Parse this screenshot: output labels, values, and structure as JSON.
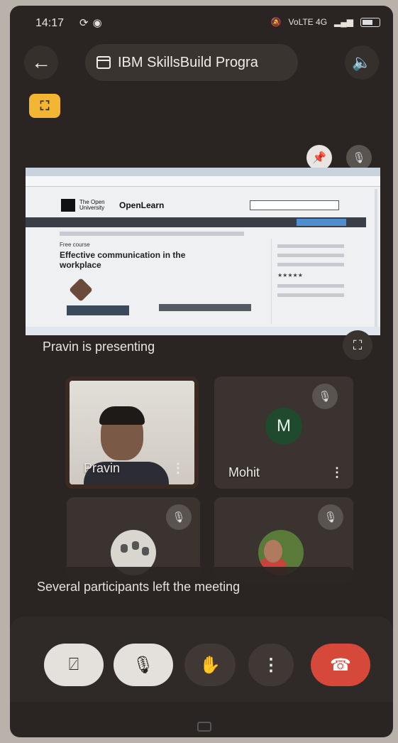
{
  "status_bar": {
    "time": "14:17",
    "left_icons": [
      "sync-icon",
      "whatsapp-icon"
    ],
    "right_text": "VoLTE 4G"
  },
  "header": {
    "back_icon": "arrow-left-icon",
    "title": "IBM SkillsBuild Progra",
    "title_icon": "calendar-icon",
    "speaker_icon": "speaker-icon"
  },
  "app_badge": {
    "text": "⛶",
    "color": "#f2b632"
  },
  "screen_share": {
    "presenter_label": "Pravin is presenting",
    "content": {
      "site_brand": "OpenLearn",
      "university": "The Open University",
      "free_course_label": "Free course",
      "course_title": "Effective communication in the workplace",
      "rating": "★★★★★"
    }
  },
  "participants": [
    {
      "name": "Pravin",
      "video": true,
      "more_icon": "more-vertical-icon"
    },
    {
      "name": "Mohit",
      "avatar_letter": "M",
      "avatar_color": "#1f4a2e",
      "muted": true,
      "more_icon": "more-vertical-icon"
    },
    {
      "name": "",
      "muted": true
    },
    {
      "name": "",
      "muted": true
    }
  ],
  "toast": "Several participants left the meeting",
  "controls": {
    "camera": "camera-off-icon",
    "mic": "mic-off-icon",
    "raise_hand": "raise-hand-icon",
    "more": "more-vertical-icon",
    "end_call": "end-call-icon",
    "end_color": "#d5483a"
  }
}
